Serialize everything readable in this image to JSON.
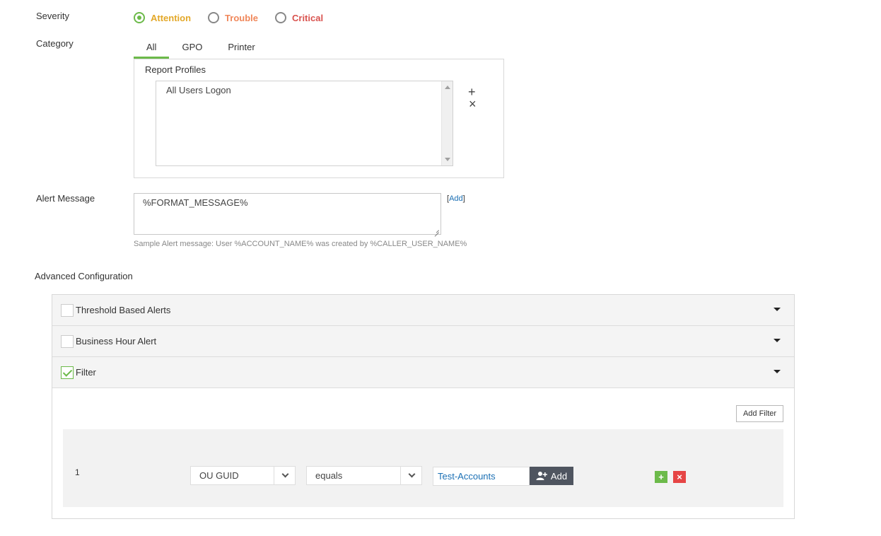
{
  "severity": {
    "label": "Severity",
    "options": [
      {
        "label": "Attention",
        "color": "#e3a829",
        "selected": true
      },
      {
        "label": "Trouble",
        "color": "#f0875a",
        "selected": false
      },
      {
        "label": "Critical",
        "color": "#d9534f",
        "selected": false
      }
    ]
  },
  "category": {
    "label": "Category",
    "tabs": [
      {
        "label": "All",
        "active": true
      },
      {
        "label": "GPO",
        "active": false
      },
      {
        "label": "Printer",
        "active": false
      }
    ],
    "profiles_label": "Report Profiles",
    "profiles": [
      "All Users Logon"
    ],
    "add_icon": "+",
    "remove_icon": "×"
  },
  "alert_message": {
    "label": "Alert Message",
    "value": "%FORMAT_MESSAGE%",
    "add_link_open": "[",
    "add_link": "Add",
    "add_link_close": "]",
    "hint": "Sample Alert message: User %ACCOUNT_NAME% was created by %CALLER_USER_NAME%"
  },
  "advanced": {
    "label": "Advanced Configuration",
    "sections": [
      {
        "title": "Threshold Based Alerts",
        "checked": false
      },
      {
        "title": "Business Hour Alert",
        "checked": false
      },
      {
        "title": "Filter",
        "checked": true
      }
    ],
    "add_filter_label": "Add Filter",
    "filter_rows": [
      {
        "index": "1",
        "field": "OU GUID",
        "operator": "equals",
        "value": "Test-Accounts",
        "add_label": "Add"
      }
    ],
    "add_row_icon": "+",
    "remove_row_icon": "×"
  },
  "colors": {
    "accent_green": "#6cba4a",
    "link_blue": "#1a6fb4",
    "dark_button": "#4f5560",
    "danger_red": "#e64545"
  }
}
